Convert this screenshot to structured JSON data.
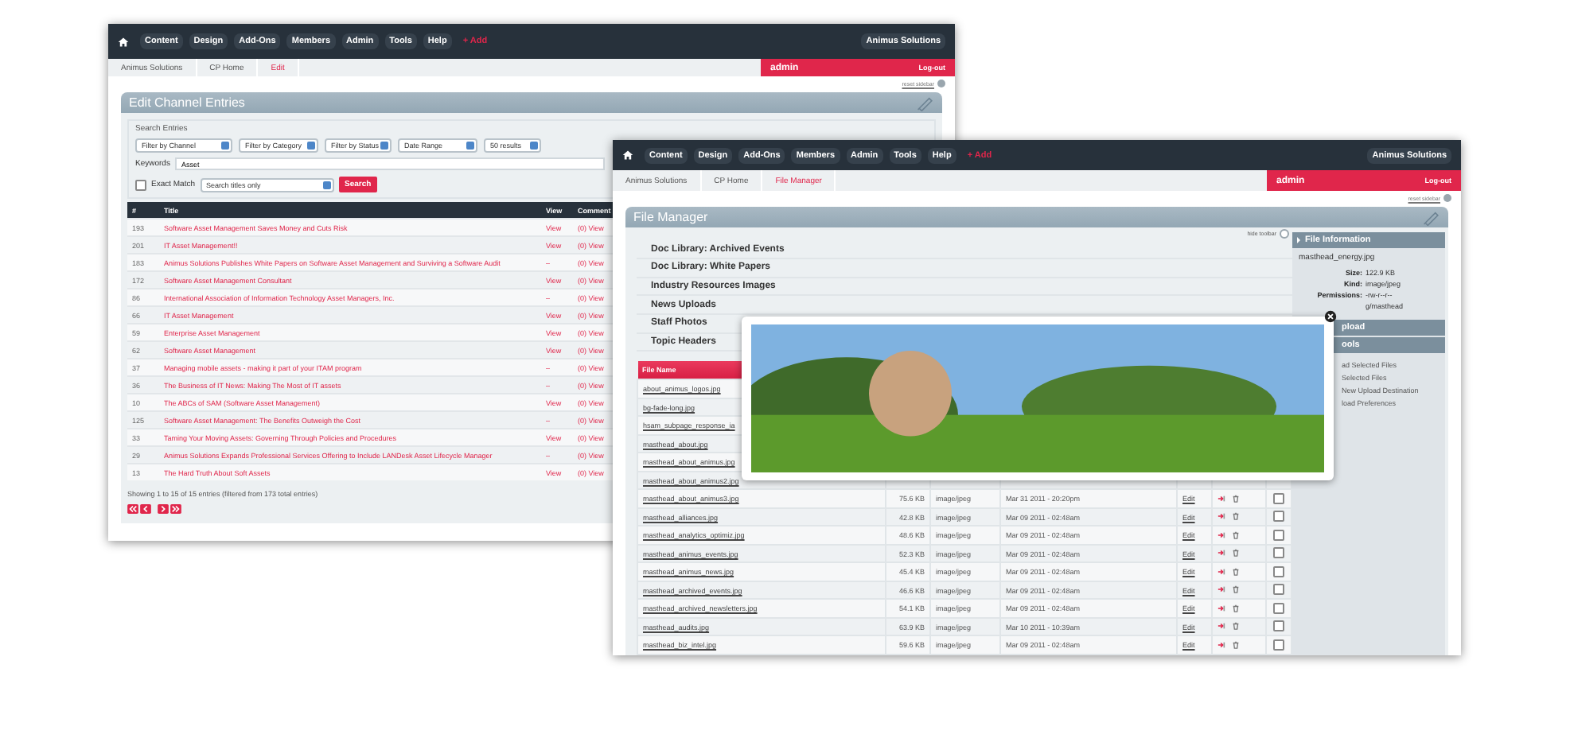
{
  "entries_window": {
    "nav": [
      {
        "label": "Content",
        "kind": "menu"
      },
      {
        "label": "Design",
        "kind": "menu"
      },
      {
        "label": "Add-Ons",
        "kind": "menu"
      },
      {
        "label": "Members",
        "kind": "menu"
      },
      {
        "label": "Admin",
        "kind": "menu"
      },
      {
        "label": "Tools",
        "kind": "menu"
      },
      {
        "label": "Help",
        "kind": "menu"
      },
      {
        "label": "+ Add",
        "kind": "add"
      }
    ],
    "site_name": "Animus Solutions",
    "breadcrumbs": [
      {
        "label": "Animus Solutions",
        "current": false
      },
      {
        "label": "CP Home",
        "current": false
      },
      {
        "label": "Edit",
        "current": true
      }
    ],
    "user": "admin",
    "logout": "Log-out",
    "reset_sidebar": "reset sidebar",
    "title": "Edit Channel Entries",
    "search": {
      "legend": "Search Entries",
      "filters": [
        "Filter by Channel",
        "Filter by Category",
        "Filter by Status",
        "Date Range",
        "50 results"
      ],
      "keywords_label": "Keywords",
      "keywords_value": "Asset",
      "exact_match": {
        "label": "Exact Match",
        "checked": false
      },
      "scope": "Search titles only",
      "button": "Search"
    },
    "table": {
      "columns": [
        "#",
        "Title",
        "View",
        "Comment"
      ],
      "rows": [
        {
          "id": "193",
          "title": "Software Asset Management Saves Money and Cuts Risk",
          "view": "View",
          "comments": "(0) View"
        },
        {
          "id": "201",
          "title": "IT Asset Management!!",
          "view": "View",
          "comments": "(0) View"
        },
        {
          "id": "183",
          "title": "Animus Solutions Publishes White Papers on Software Asset Management and Surviving a Software Audit",
          "view": "–",
          "comments": "(0) View"
        },
        {
          "id": "172",
          "title": "Software Asset Management Consultant",
          "view": "View",
          "comments": "(0) View"
        },
        {
          "id": "86",
          "title": "International Association of Information Technology Asset Managers, Inc.",
          "view": "–",
          "comments": "(0) View"
        },
        {
          "id": "66",
          "title": "IT Asset Management",
          "view": "View",
          "comments": "(0) View"
        },
        {
          "id": "59",
          "title": "Enterprise Asset Management",
          "view": "View",
          "comments": "(0) View"
        },
        {
          "id": "62",
          "title": "Software Asset Management",
          "view": "View",
          "comments": "(0) View"
        },
        {
          "id": "37",
          "title": "Managing mobile assets - making it part of your ITAM program",
          "view": "–",
          "comments": "(0) View"
        },
        {
          "id": "36",
          "title": "The Business of IT News: Making The Most of IT assets",
          "view": "–",
          "comments": "(0) View"
        },
        {
          "id": "10",
          "title": "The ABCs of SAM (Software Asset Management)",
          "view": "View",
          "comments": "(0) View"
        },
        {
          "id": "125",
          "title": "Software Asset Management: The Benefits Outweigh the Cost",
          "view": "–",
          "comments": "(0) View"
        },
        {
          "id": "33",
          "title": "Taming Your Moving Assets: Governing Through Policies and Procedures",
          "view": "View",
          "comments": "(0) View"
        },
        {
          "id": "29",
          "title": "Animus Solutions Expands Professional Services Offering to Include LANDesk Asset Lifecycle Manager",
          "view": "–",
          "comments": "(0) View"
        },
        {
          "id": "13",
          "title": "The Hard Truth About Soft Assets",
          "view": "View",
          "comments": "(0) View"
        }
      ]
    },
    "summary": "Showing 1 to 15 of 15 entries (filtered from 173 total entries)"
  },
  "file_window": {
    "nav": [
      {
        "label": "Content",
        "kind": "menu"
      },
      {
        "label": "Design",
        "kind": "menu"
      },
      {
        "label": "Add-Ons",
        "kind": "menu"
      },
      {
        "label": "Members",
        "kind": "menu"
      },
      {
        "label": "Admin",
        "kind": "menu"
      },
      {
        "label": "Tools",
        "kind": "menu"
      },
      {
        "label": "Help",
        "kind": "menu"
      },
      {
        "label": "+ Add",
        "kind": "add"
      }
    ],
    "site_name": "Animus Solutions",
    "breadcrumbs": [
      {
        "label": "Animus Solutions",
        "current": false
      },
      {
        "label": "CP Home",
        "current": false
      },
      {
        "label": "File Manager",
        "current": true
      }
    ],
    "user": "admin",
    "logout": "Log-out",
    "reset_sidebar": "reset sidebar",
    "title": "File Manager",
    "hide_toolbar": "hide toolbar",
    "folders": [
      "Doc Library: Archived Events",
      "Doc Library: White Papers",
      "Industry Resources Images",
      "News Uploads",
      "Staff Photos",
      "Topic Headers"
    ],
    "table": {
      "columns": [
        "File Name"
      ],
      "rows": [
        {
          "name": "about_animus_logos.jpg"
        },
        {
          "name": "bg-fade-long.jpg"
        },
        {
          "name": "hsam_subpage_response_ia"
        },
        {
          "name": "masthead_about.jpg"
        },
        {
          "name": "masthead_about_animus.jpg"
        },
        {
          "name": "masthead_about_animus2.jpg"
        },
        {
          "name": "masthead_about_animus3.jpg",
          "size": "75.6 KB",
          "kind": "image/jpeg",
          "date": "Mar 31 2011 - 20:20pm",
          "edit": "Edit",
          "checked": false
        },
        {
          "name": "masthead_alliances.jpg",
          "size": "42.8 KB",
          "kind": "image/jpeg",
          "date": "Mar 09 2011 - 02:48am",
          "edit": "Edit",
          "checked": false
        },
        {
          "name": "masthead_analytics_optimiz.jpg",
          "size": "48.6 KB",
          "kind": "image/jpeg",
          "date": "Mar 09 2011 - 02:48am",
          "edit": "Edit",
          "checked": false
        },
        {
          "name": "masthead_animus_events.jpg",
          "size": "52.3 KB",
          "kind": "image/jpeg",
          "date": "Mar 09 2011 - 02:48am",
          "edit": "Edit",
          "checked": false
        },
        {
          "name": "masthead_animus_news.jpg",
          "size": "45.4 KB",
          "kind": "image/jpeg",
          "date": "Mar 09 2011 - 02:48am",
          "edit": "Edit",
          "checked": false
        },
        {
          "name": "masthead_archived_events.jpg",
          "size": "46.6 KB",
          "kind": "image/jpeg",
          "date": "Mar 09 2011 - 02:48am",
          "edit": "Edit",
          "checked": false
        },
        {
          "name": "masthead_archived_newsletters.jpg",
          "size": "54.1 KB",
          "kind": "image/jpeg",
          "date": "Mar 09 2011 - 02:48am",
          "edit": "Edit",
          "checked": false
        },
        {
          "name": "masthead_audits.jpg",
          "size": "63.9 KB",
          "kind": "image/jpeg",
          "date": "Mar 10 2011 - 10:39am",
          "edit": "Edit",
          "checked": false
        },
        {
          "name": "masthead_biz_intel.jpg",
          "size": "59.6 KB",
          "kind": "image/jpeg",
          "date": "Mar 09 2011 - 02:48am",
          "edit": "Edit",
          "checked": false
        }
      ]
    },
    "file_info": {
      "title": "File Information",
      "file_name": "masthead_energy.jpg",
      "details": [
        {
          "label": "Size:",
          "value": "122.9 KB"
        },
        {
          "label": "Kind:",
          "value": "image/jpeg"
        },
        {
          "label": "Permissions:",
          "value": "-rw-r--r--"
        }
      ],
      "location": "g/masthead"
    },
    "sections": [
      {
        "title": "pload"
      },
      {
        "title": "ools",
        "links": [
          "ad Selected Files",
          "Selected Files",
          "New Upload Destination",
          "load Preferences"
        ]
      }
    ]
  }
}
